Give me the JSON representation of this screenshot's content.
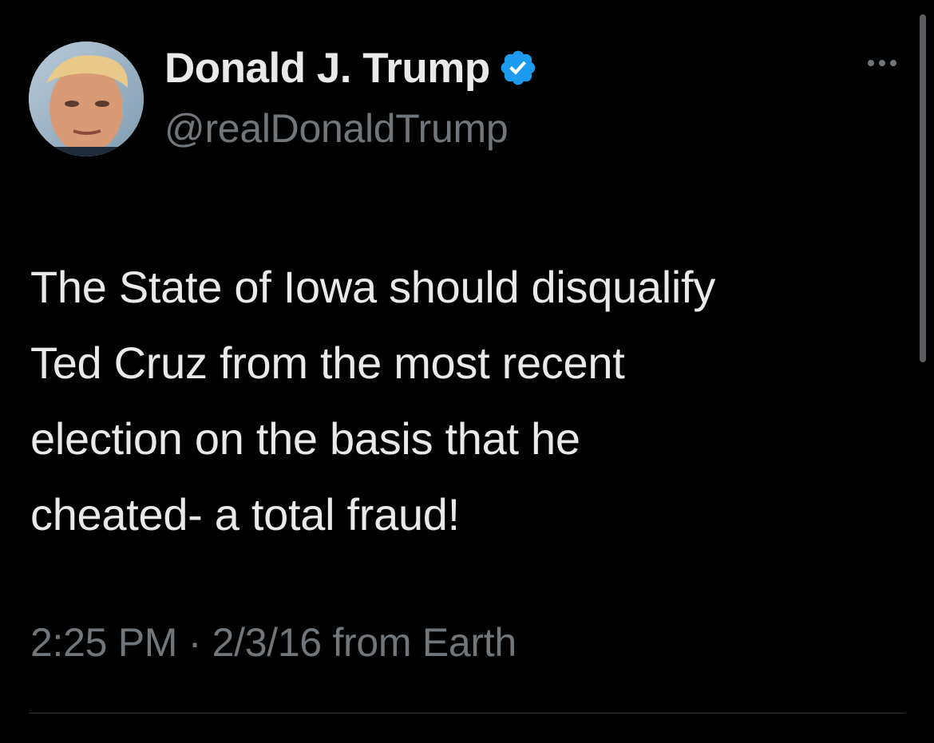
{
  "author": {
    "display_name": "Donald J. Trump",
    "handle": "@realDonaldTrump",
    "verified": true,
    "avatar_icon": "profile-photo"
  },
  "tweet": {
    "text_lines": [
      "The State of Iowa should disqualify",
      "Ted Cruz from the most recent",
      "election on the basis that he",
      "cheated- a total fraud!"
    ],
    "time": "2:25 PM",
    "separator": "·",
    "date": "2/3/16",
    "source": "from Earth"
  },
  "icons": {
    "verified": "verified-badge-icon",
    "more": "more-options-icon"
  },
  "colors": {
    "background": "#000000",
    "text_primary": "#e7e9ea",
    "text_secondary": "#71767b",
    "verified_blue": "#1d9bf0",
    "divider": "#2f3336"
  }
}
